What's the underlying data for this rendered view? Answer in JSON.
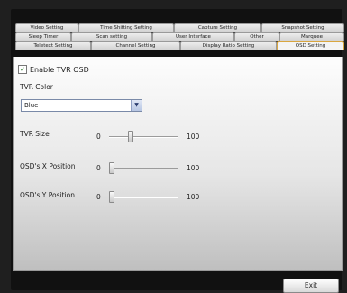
{
  "tabs": {
    "row1": [
      "Video Setting",
      "Time Shifting Setting",
      "Capture Setting",
      "Snapshot Setting"
    ],
    "row2": [
      "Sleep Timer",
      "Scan setting",
      "User Interface",
      "Other",
      "Marquee"
    ],
    "row3": [
      "Teletext Setting",
      "Channel Setting",
      "Display Ratio Setting",
      "OSD Setting"
    ],
    "active": "OSD Setting"
  },
  "osd": {
    "enable_label": "Enable TVR OSD",
    "enable_checked": true,
    "check_glyph": "✓",
    "color_label": "TVR Color",
    "color_value": "Blue",
    "arrow_glyph": "▼",
    "size_label": "TVR Size",
    "x_label": "OSD's X Position",
    "y_label": "OSD's Y Position",
    "min": "0",
    "max": "100",
    "size_value": 30,
    "x_value": 0,
    "y_value": 0
  },
  "footer": {
    "exit_label": "Exit"
  }
}
